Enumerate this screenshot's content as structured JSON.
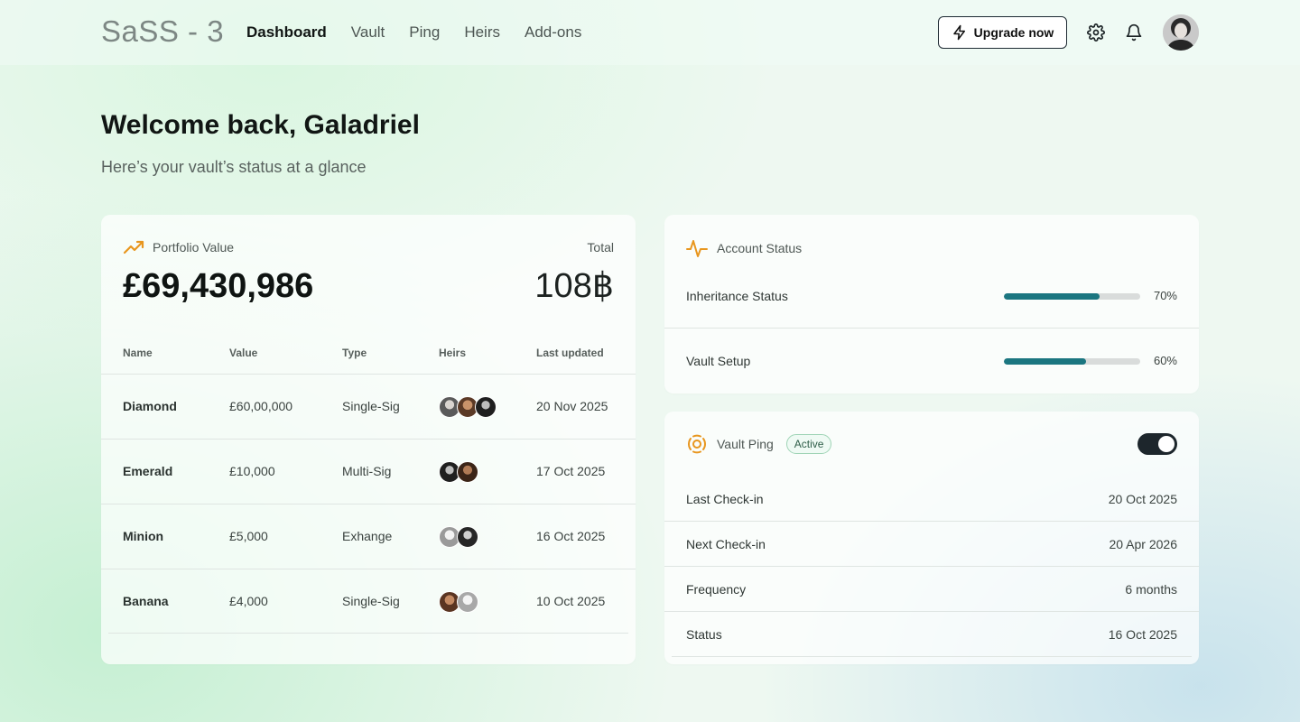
{
  "header": {
    "logo": "SaSS - 3",
    "nav": [
      {
        "label": "Dashboard",
        "active": true
      },
      {
        "label": "Vault",
        "active": false
      },
      {
        "label": "Ping",
        "active": false
      },
      {
        "label": "Heirs",
        "active": false
      },
      {
        "label": "Add-ons",
        "active": false
      }
    ],
    "upgrade_label": "Upgrade now",
    "icons": {
      "upgrade": "lightning-icon",
      "settings": "gear-icon",
      "notifications": "bell-icon"
    }
  },
  "welcome": {
    "title": "Welcome back, Galadriel",
    "subtitle": "Here’s your vault’s status at a glance"
  },
  "portfolio": {
    "label": "Portfolio Value",
    "value": "£69,430,986",
    "total_label": "Total",
    "total_value": "108฿",
    "columns": [
      "Name",
      "Value",
      "Type",
      "Heirs",
      "Last updated"
    ],
    "rows": [
      {
        "name": "Diamond",
        "value": "£60,00,000",
        "type": "Single-Sig",
        "heirs_count": 3,
        "updated": "20 Nov 2025"
      },
      {
        "name": "Emerald",
        "value": "£10,000",
        "type": "Multi-Sig",
        "heirs_count": 2,
        "updated": "17 Oct 2025"
      },
      {
        "name": "Minion",
        "value": "£5,000",
        "type": "Exhange",
        "heirs_count": 2,
        "updated": "16 Oct 2025"
      },
      {
        "name": "Banana",
        "value": "£4,000",
        "type": "Single-Sig",
        "heirs_count": 2,
        "updated": "10 Oct 2025"
      }
    ]
  },
  "account_status": {
    "label": "Account Status",
    "items": [
      {
        "label": "Inheritance Status",
        "percent_text": "70%",
        "progress": 0.7
      },
      {
        "label": "Vault Setup",
        "percent_text": "60%",
        "progress": 0.6
      }
    ]
  },
  "vault_ping": {
    "label": "Vault Ping",
    "badge": "Active",
    "enabled": true,
    "rows": [
      {
        "key": "Last Check-in",
        "value": "20 Oct 2025"
      },
      {
        "key": "Next Check-in",
        "value": "20 Apr 2026"
      },
      {
        "key": "Frequency",
        "value": "6 months"
      },
      {
        "key": "Status",
        "value": "16 Oct 2025"
      }
    ]
  },
  "colors": {
    "accent": "#1b7680",
    "orange": "#e8961e",
    "active_badge": "#9fd4b6"
  }
}
